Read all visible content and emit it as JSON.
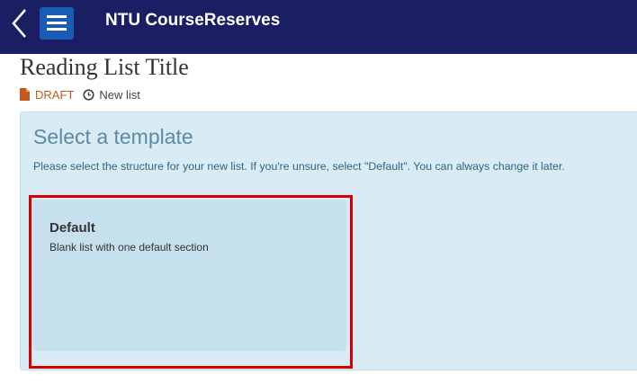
{
  "header": {
    "app_title": "NTU CourseReserves",
    "back_icon": "chevron-left-icon",
    "menu_icon": "hamburger-menu-icon",
    "bg_color": "#1a1f63",
    "menu_button_color": "#1a5bb5"
  },
  "page": {
    "title": "Reading List Title",
    "status_label": "DRAFT",
    "status_icon": "document-icon",
    "status_color": "#c05a1e",
    "list_state_icon": "clock-icon",
    "list_state_label": "New list"
  },
  "template_panel": {
    "title": "Select a template",
    "description": "Please select the structure for your new list. If you're unsure, select \"Default\". You can always change it later.",
    "templates": [
      {
        "name": "Default",
        "description": "Blank list with one default section",
        "highlighted": true
      }
    ],
    "highlight_color": "#d40000"
  }
}
